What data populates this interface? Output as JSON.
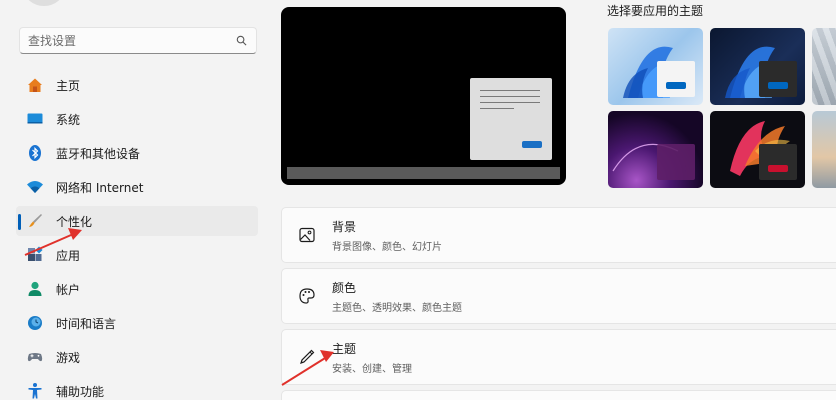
{
  "search": {
    "placeholder": "查找设置"
  },
  "nav": {
    "items": [
      {
        "label": "主页",
        "icon": "home-icon"
      },
      {
        "label": "系统",
        "icon": "monitor-icon"
      },
      {
        "label": "蓝牙和其他设备",
        "icon": "bluetooth-icon"
      },
      {
        "label": "网络和 Internet",
        "icon": "wifi-icon"
      },
      {
        "label": "个性化",
        "icon": "brush-icon",
        "active": true
      },
      {
        "label": "应用",
        "icon": "apps-icon"
      },
      {
        "label": "帐户",
        "icon": "person-icon"
      },
      {
        "label": "时间和语言",
        "icon": "clock-globe-icon"
      },
      {
        "label": "游戏",
        "icon": "gamepad-icon"
      },
      {
        "label": "辅助功能",
        "icon": "accessibility-icon"
      }
    ]
  },
  "themes": {
    "title": "选择要应用的主题",
    "items": [
      {
        "name": "windows-light",
        "accent": "#0067c0"
      },
      {
        "name": "windows-dark",
        "accent": "#0067c0"
      },
      {
        "name": "glow",
        "accent": "#5e1f68"
      },
      {
        "name": "captured-motion",
        "accent": "#c8102e"
      },
      {
        "name": "flow",
        "accent": "#8a8a8a"
      },
      {
        "name": "sunrise",
        "accent": "#8a8a8a"
      }
    ]
  },
  "cards": [
    {
      "title": "背景",
      "subtitle": "背景图像、颜色、幻灯片",
      "icon": "image-icon"
    },
    {
      "title": "颜色",
      "subtitle": "主题色、透明效果、颜色主题",
      "icon": "palette-icon"
    },
    {
      "title": "主题",
      "subtitle": "安装、创建、管理",
      "icon": "pen-icon"
    }
  ],
  "colors": {
    "accent": "#005fb8",
    "annotation_arrow": "#e0312b"
  }
}
